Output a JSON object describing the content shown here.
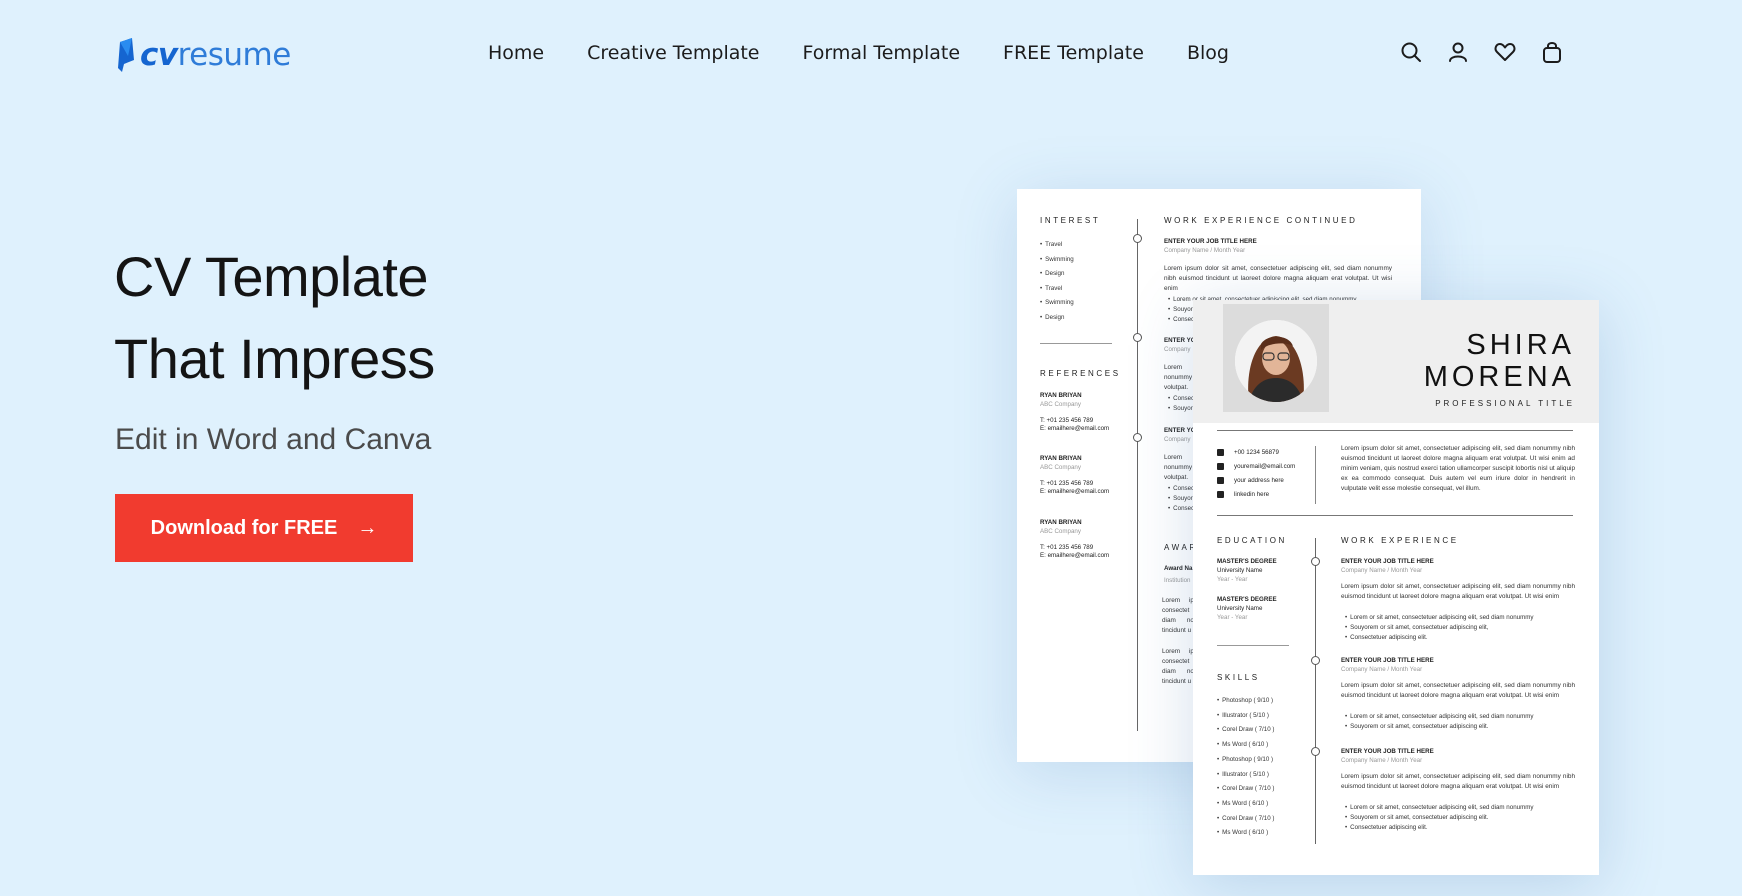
{
  "brand": {
    "name_bold": "cv",
    "name_rest": "resume",
    "accent": "#1a6fd6"
  },
  "nav": {
    "items": [
      {
        "label": "Home"
      },
      {
        "label": "Creative Template"
      },
      {
        "label": "Formal Template"
      },
      {
        "label": "FREE Template"
      },
      {
        "label": "Blog"
      }
    ]
  },
  "header_icons": [
    "search-icon",
    "user-icon",
    "heart-icon",
    "bag-icon"
  ],
  "hero": {
    "title_line1": "CV Template",
    "title_line2": "That Impress",
    "subtitle": "Edit in Word and Canva",
    "cta_label": "Download for FREE",
    "cta_arrow": "→",
    "cta_color": "#f13b2f"
  },
  "resume_back": {
    "interest_heading": "INTEREST",
    "interests": [
      "Travel",
      "Swimming",
      "Design",
      "Travel",
      "Swimming",
      "Design"
    ],
    "references_heading": "REFERENCES",
    "references": [
      {
        "name": "RYAN BRIYAN",
        "company": "ABC Company",
        "phone": "T: +01 235 456 789",
        "email": "E: emailhere@email.com"
      },
      {
        "name": "RYAN BRIYAN",
        "company": "ABC Company",
        "phone": "T: +01 235 456 789",
        "email": "E: emailhere@email.com"
      },
      {
        "name": "RYAN BRIYAN",
        "company": "ABC Company",
        "phone": "T: +01 235 456 789",
        "email": "E: emailhere@email.com"
      }
    ],
    "work_heading": "WORK EXPERIENCE CONTINUED",
    "job_title": "ENTER YOUR JOB TITLE HERE",
    "job_title_partial": "ENTER YO",
    "company_line": "Company Name / Month Year",
    "company_partial": "Company",
    "lorem": "Lorem ipsum dolor sit amet, consectetuer adipiscing elit, sed diam nonummy nibh euismod tincidunt ut laoreet dolore magna aliquam erat volutpat. Ut wisi enim",
    "lorem_partial": "Lorem ip nonummy volutpat.",
    "bullet_1": "Lorem or sit amet, consectetuer adipiscing elit, sed diam nonummy",
    "bullet_2": "Souyorem",
    "bullet_3": "Consec",
    "awards_heading": "AWAR",
    "award_name": "Award Na",
    "award_inst": "Institution",
    "award_lorem": "Lorem ip consectet diam no tincidunt u"
  },
  "resume_front": {
    "first_name": "SHIRA",
    "last_name": "MORENA",
    "professional_title": "PROFESSIONAL TITLE",
    "contacts": [
      {
        "icon": "phone-icon",
        "text": "+00 1234 56879"
      },
      {
        "icon": "mail-icon",
        "text": "youremail@email.com"
      },
      {
        "icon": "home-icon",
        "text": "your address here"
      },
      {
        "icon": "linkedin-icon",
        "text": "linkedin here"
      }
    ],
    "profile": "Lorem ipsum dolor sit amet, consectetuer adipiscing elit, sed diam nonummy nibh euismod tincidunt ut laoreet dolore magna aliquam erat volutpat. Ut wisi enim ad minim veniam, quis nostrud exerci tation ullamcorper suscipit lobortis nisl ut aliquip ex ea commodo consequat. Duis autem vel eum iriure dolor in hendrerit in vulputate velit esse molestie consequat, vel illum.",
    "education_heading": "EDUCATION",
    "education": [
      {
        "degree": "MASTER'S DEGREE",
        "school": "University Name",
        "years": "Year - Year"
      },
      {
        "degree": "MASTER'S DEGREE",
        "school": "University Name",
        "years": "Year - Year"
      }
    ],
    "skills_heading": "SKILLS",
    "skills": [
      "Photoshop ( 9/10 )",
      "Illustrator ( 5/10 )",
      "Corel Draw ( 7/10 )",
      "Ms Word ( 6/10 )",
      "Photoshop ( 9/10 )",
      "Illustrator ( 5/10 )",
      "Corel Draw ( 7/10 )",
      "Ms Word ( 6/10 )",
      "Corel Draw ( 7/10 )",
      "Ms Word ( 6/10 )"
    ],
    "work_heading": "WORK EXPERIENCE",
    "jobs": [
      {
        "title": "ENTER YOUR JOB TITLE HERE",
        "company": "Company Name / Month Year",
        "bullets": [
          "Lorem or sit amet, consectetuer adipiscing elit, sed diam nonummy",
          "Souyorem or sit amet, consectetuer adipiscing elit,",
          "Consectetuer adipiscing elit."
        ]
      },
      {
        "title": "ENTER YOUR JOB TITLE HERE",
        "company": "Company Name / Month Year",
        "bullets": [
          "Lorem or sit amet, consectetuer adipiscing elit, sed diam nonummy",
          "Souyorem or sit amet, consectetuer adipiscing elit."
        ]
      },
      {
        "title": "ENTER YOUR JOB TITLE HERE",
        "company": "Company Name / Month Year",
        "bullets": [
          "Lorem or sit amet, consectetuer adipiscing elit, sed diam nonummy",
          "Souyorem or sit amet, consectetuer adipiscing elit.",
          "Consectetuer adipiscing elit."
        ]
      }
    ],
    "job_lorem": "Lorem ipsum dolor sit amet, consectetuer adipiscing elit, sed diam nonummy nibh euismod tincidunt ut laoreet dolore magna aliquam erat volutpat. Ut wisi enim"
  }
}
